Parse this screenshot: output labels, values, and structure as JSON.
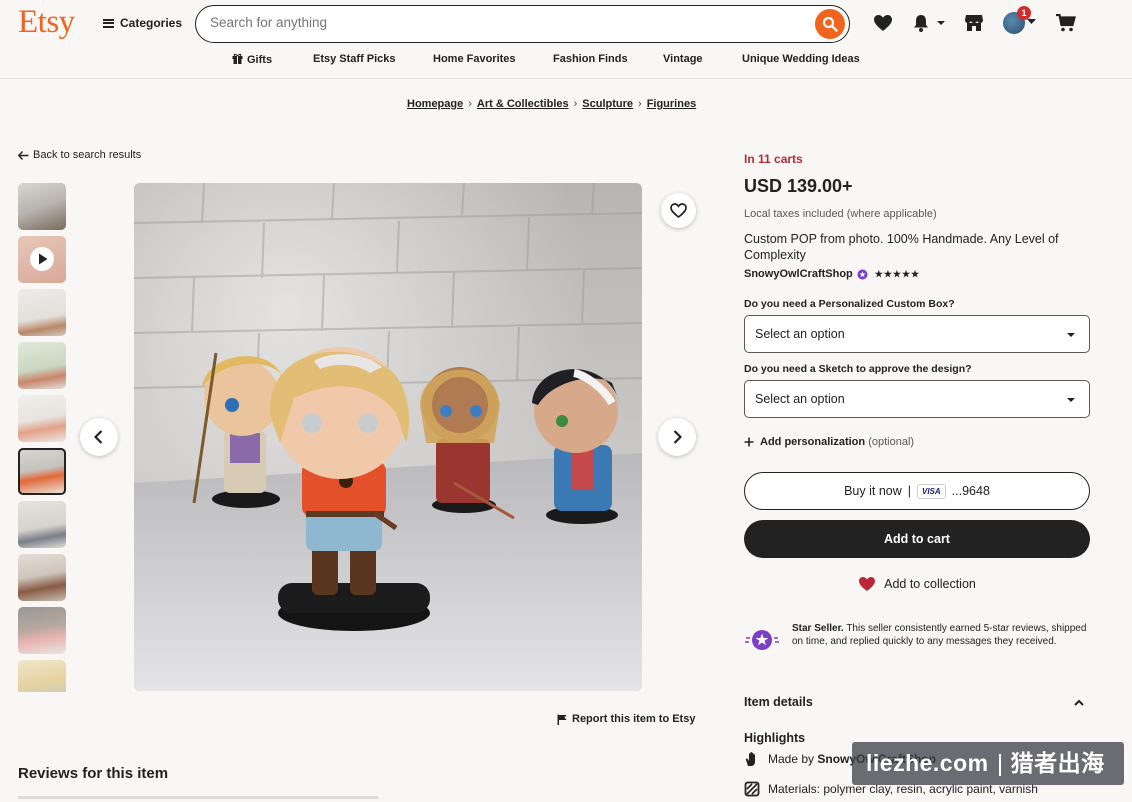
{
  "header": {
    "logo": "Etsy",
    "categories_label": "Categories",
    "search_placeholder": "Search for anything",
    "notification_count": "1"
  },
  "nav": {
    "items": [
      "Gifts",
      "Etsy Staff Picks",
      "Home Favorites",
      "Fashion Finds",
      "Vintage",
      "Unique Wedding Ideas"
    ]
  },
  "breadcrumb": [
    "Homepage",
    "Art & Collectibles",
    "Sculpture",
    "Figurines"
  ],
  "back_label": "Back to search results",
  "report_label": "Report this item to Etsy",
  "reviews_title": "Reviews for this item",
  "product": {
    "in_carts": "In 11 carts",
    "price": "USD 139.00+",
    "tax_note": "Local taxes included (where applicable)",
    "title": "Custom POP from photo. 100% Handmade. Any Level of Complexity",
    "shop_name": "SnowyOwlCraftShop",
    "stars": "★★★★★",
    "option1_label": "Do you need a Personalized Custom Box?",
    "option1_value": "Select an option",
    "option2_label": "Do you need a Sketch to approve the design?",
    "option2_value": "Select an option",
    "add_personalization": "Add personalization",
    "optional": "(optional)",
    "buy_now": "Buy it now",
    "buy_now_sep": "|",
    "card_brand": "VISA",
    "card_last4": "...9648",
    "add_to_cart": "Add to cart",
    "add_to_collection": "Add to collection",
    "star_seller_bold": "Star Seller.",
    "star_seller_text": "This seller consistently earned 5-star reviews, shipped on time, and replied quickly to any messages they received.",
    "item_details": "Item details",
    "highlights": "Highlights",
    "made_by_prefix": "Made by",
    "made_by_shop": "SnowyOwlCraftShop",
    "materials": "Materials: polymer clay, resin, acrylic paint, varnish"
  },
  "watermark": {
    "left": "liezhe.com",
    "right": "猎者出海"
  },
  "colors": {
    "brand": "#f1641e",
    "alert": "#b9283a",
    "dark": "#222222",
    "star_seller": "#7b3fc7"
  }
}
